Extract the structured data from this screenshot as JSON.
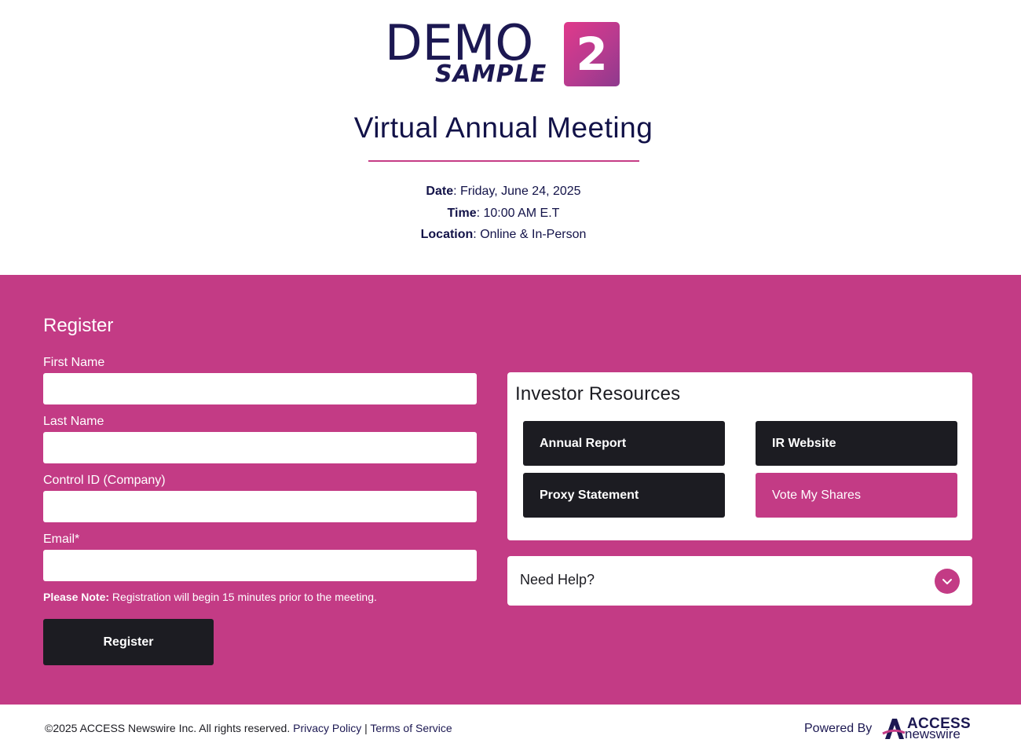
{
  "logo": {
    "demo": "DEMO",
    "sample": "SAMPLE",
    "badge": "2"
  },
  "meeting": {
    "title": "Virtual Annual Meeting",
    "date_label": "Date",
    "date_value": ": Friday, June 24, 2025",
    "time_label": "Time",
    "time_value": ": 10:00 AM E.T",
    "location_label": "Location",
    "location_value": ": Online & In-Person"
  },
  "register": {
    "title": "Register",
    "fields": [
      {
        "label": "First Name",
        "value": ""
      },
      {
        "label": "Last Name",
        "value": ""
      },
      {
        "label": "Control ID (Company)",
        "value": ""
      },
      {
        "label": "Email*",
        "value": ""
      }
    ],
    "note_label": "Please Note:",
    "note_text": " Registration will begin 15 minutes prior to the meeting.",
    "button": "Register"
  },
  "resources": {
    "title": "Investor Resources",
    "buttons": [
      "Annual Report",
      "IR Website",
      "Proxy Statement",
      "Vote My Shares"
    ]
  },
  "help": {
    "label": "Need Help?"
  },
  "footer": {
    "copyright": "©2025 ACCESS Newswire Inc. All rights reserved.",
    "privacy": "Privacy Policy",
    "separator": "|",
    "terms": "Terms of Service",
    "powered_by": "Powered By",
    "brand_top": "ACCESS",
    "brand_bottom": "newswire"
  },
  "colors": {
    "brand_navy": "#121248",
    "brand_pink": "#c33b85",
    "button_dark": "#1c1c22"
  }
}
